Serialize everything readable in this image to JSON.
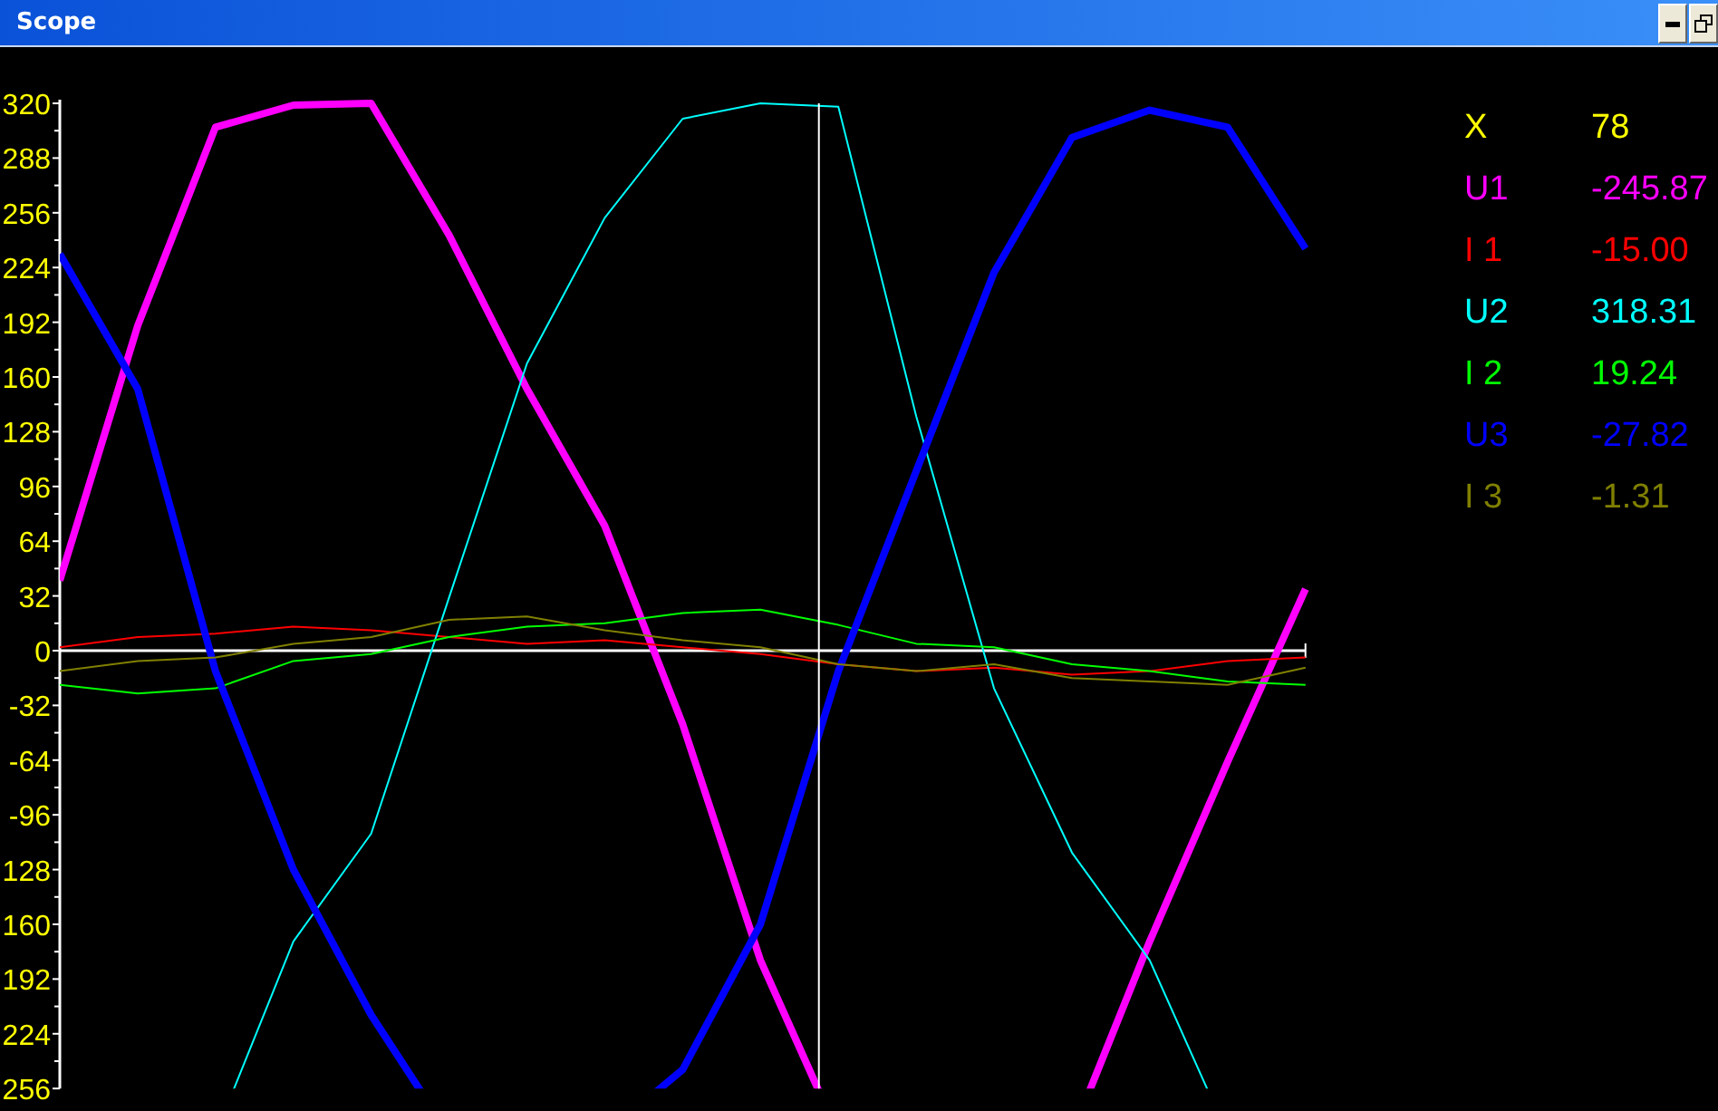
{
  "window": {
    "title": "Scope"
  },
  "scope": {
    "chart_data": {
      "type": "line",
      "categories": [
        null,
        null,
        null,
        null,
        null,
        null,
        null,
        null,
        null,
        null,
        null,
        null,
        null,
        null,
        null,
        null,
        null
      ],
      "ylim": [
        -256,
        320
      ],
      "yticks": [
        320,
        288,
        256,
        224,
        192,
        160,
        128,
        96,
        64,
        32,
        0,
        -32,
        -64,
        -96,
        {
          "value": -128,
          "label": "128"
        },
        {
          "value": -160,
          "label": "160"
        },
        {
          "value": -192,
          "label": "192"
        },
        {
          "value": -224,
          "label": "224"
        },
        {
          "value": -256,
          "label": "256"
        }
      ],
      "series": [
        {
          "name": "U1",
          "color": "#ff00ff",
          "values": [
            41,
            190,
            306,
            319,
            320,
            243,
            153,
            73,
            -43,
            -181,
            null,
            null,
            null,
            null,
            -170,
            -65,
            36
          ]
        },
        {
          "name": "I 1",
          "color": "#ff0000",
          "values": [
            2,
            8,
            10,
            14,
            12,
            8,
            4,
            6,
            2,
            -2,
            -8,
            -12,
            -10,
            -14,
            -12,
            -6,
            -4
          ]
        },
        {
          "name": "U2",
          "color": "#00ffff",
          "values": [
            null,
            null,
            null,
            -170,
            -107,
            31,
            168,
            253,
            311,
            320,
            318,
            137,
            -22,
            -118,
            -181,
            null,
            null
          ]
        },
        {
          "name": "I 2",
          "color": "#00ff00",
          "values": [
            -20,
            -25,
            -22,
            -6,
            -2,
            8,
            14,
            16,
            22,
            24,
            15,
            4,
            2,
            -8,
            -12,
            -18,
            -20
          ]
        },
        {
          "name": "U3",
          "color": "#0000ff",
          "values": [
            232,
            153,
            -12,
            -128,
            -213,
            null,
            null,
            null,
            -245,
            -160,
            -12,
            105,
            221,
            300,
            316,
            306,
            235
          ]
        },
        {
          "name": "I 3",
          "color": "#808000",
          "values": [
            -12,
            -6,
            -4,
            4,
            8,
            18,
            20,
            12,
            6,
            2,
            -8,
            -12,
            -8,
            -16,
            -18,
            -20,
            -10
          ]
        }
      ]
    }
  },
  "cursor": {
    "label": "X",
    "value": "78"
  },
  "readout_values": [
    "-245.87",
    "-15.00",
    "318.31",
    "19.24",
    "-27.82",
    "-1.31"
  ]
}
